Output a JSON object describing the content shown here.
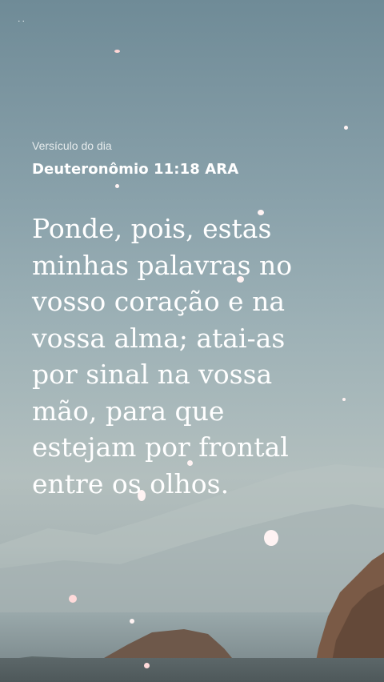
{
  "status_bar": {
    "indicator": "˙˙"
  },
  "verse_of_day": {
    "label": "Versículo do dia",
    "reference": "Deuteronômio 11:18 ARA",
    "text_lines": [
      "Ponde, pois, estas",
      "minhas palavras no",
      "vosso coração e na",
      "vossa alma; atai-as",
      "por sinal na vossa",
      "mão, para que",
      "estejam por frontal",
      "entre os olhos."
    ]
  },
  "colors": {
    "text": "#ffffff",
    "sky_top": "#6f8b97",
    "sky_bottom": "#b3bfbe"
  }
}
